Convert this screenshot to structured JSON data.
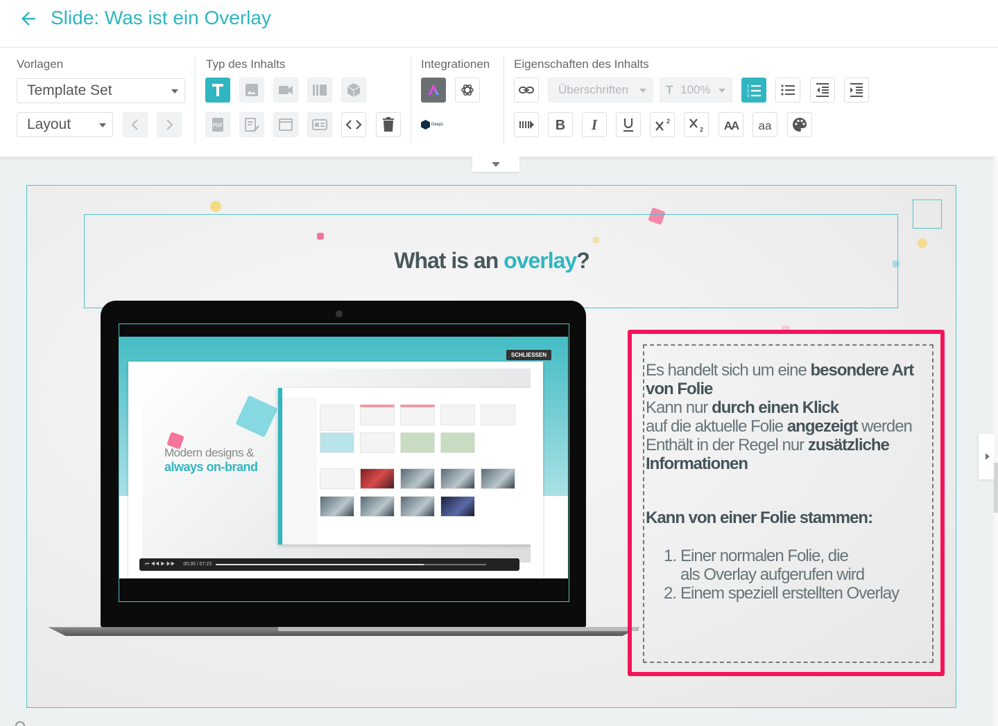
{
  "header": {
    "title": "Slide: Was ist ein Overlay"
  },
  "toolbar": {
    "vorlagen": {
      "label": "Vorlagen",
      "template_set": "Template Set",
      "layout": "Layout"
    },
    "typ": {
      "label": "Typ des Inhalts"
    },
    "integrationen": {
      "label": "Integrationen",
      "deepl_label": "DeepL"
    },
    "eigenschaften": {
      "label": "Eigenschaften des Inhalts",
      "heading_select": "Überschriften",
      "font_size": "100%"
    }
  },
  "slide": {
    "heading_main": "What is an ",
    "heading_accent": "overlay",
    "heading_end": "?",
    "laptop": {
      "close_button": "SCHLIESSEN",
      "video_text_line1": "Modern designs &",
      "video_text_line2": "always on-brand",
      "player_time": "00:30 / 07:23"
    },
    "text": {
      "p1_light": "Es handelt sich um eine ",
      "p1_bold": "besondere Art von Folie",
      "p2_light": "Kann nur ",
      "p2_bold": "durch einen Klick",
      "p3_light": "auf die aktuelle Folie ",
      "p3_bold": "angezeigt",
      "p3_end": " werden",
      "p4_light": "Enthält in der Regel nur ",
      "p4_bold": "zusätzliche Informationen",
      "subhead": "Kann von einer Folie stammen:",
      "list": [
        {
          "num": "1.",
          "line1": "Einer normalen Folie, die",
          "line2": "als Overlay aufgerufen wird"
        },
        {
          "num": "2.",
          "line1": "Einem speziell erstellten Overlay"
        }
      ]
    }
  },
  "colors": {
    "accent": "#2fb6c0",
    "highlight": "#f5145b"
  }
}
